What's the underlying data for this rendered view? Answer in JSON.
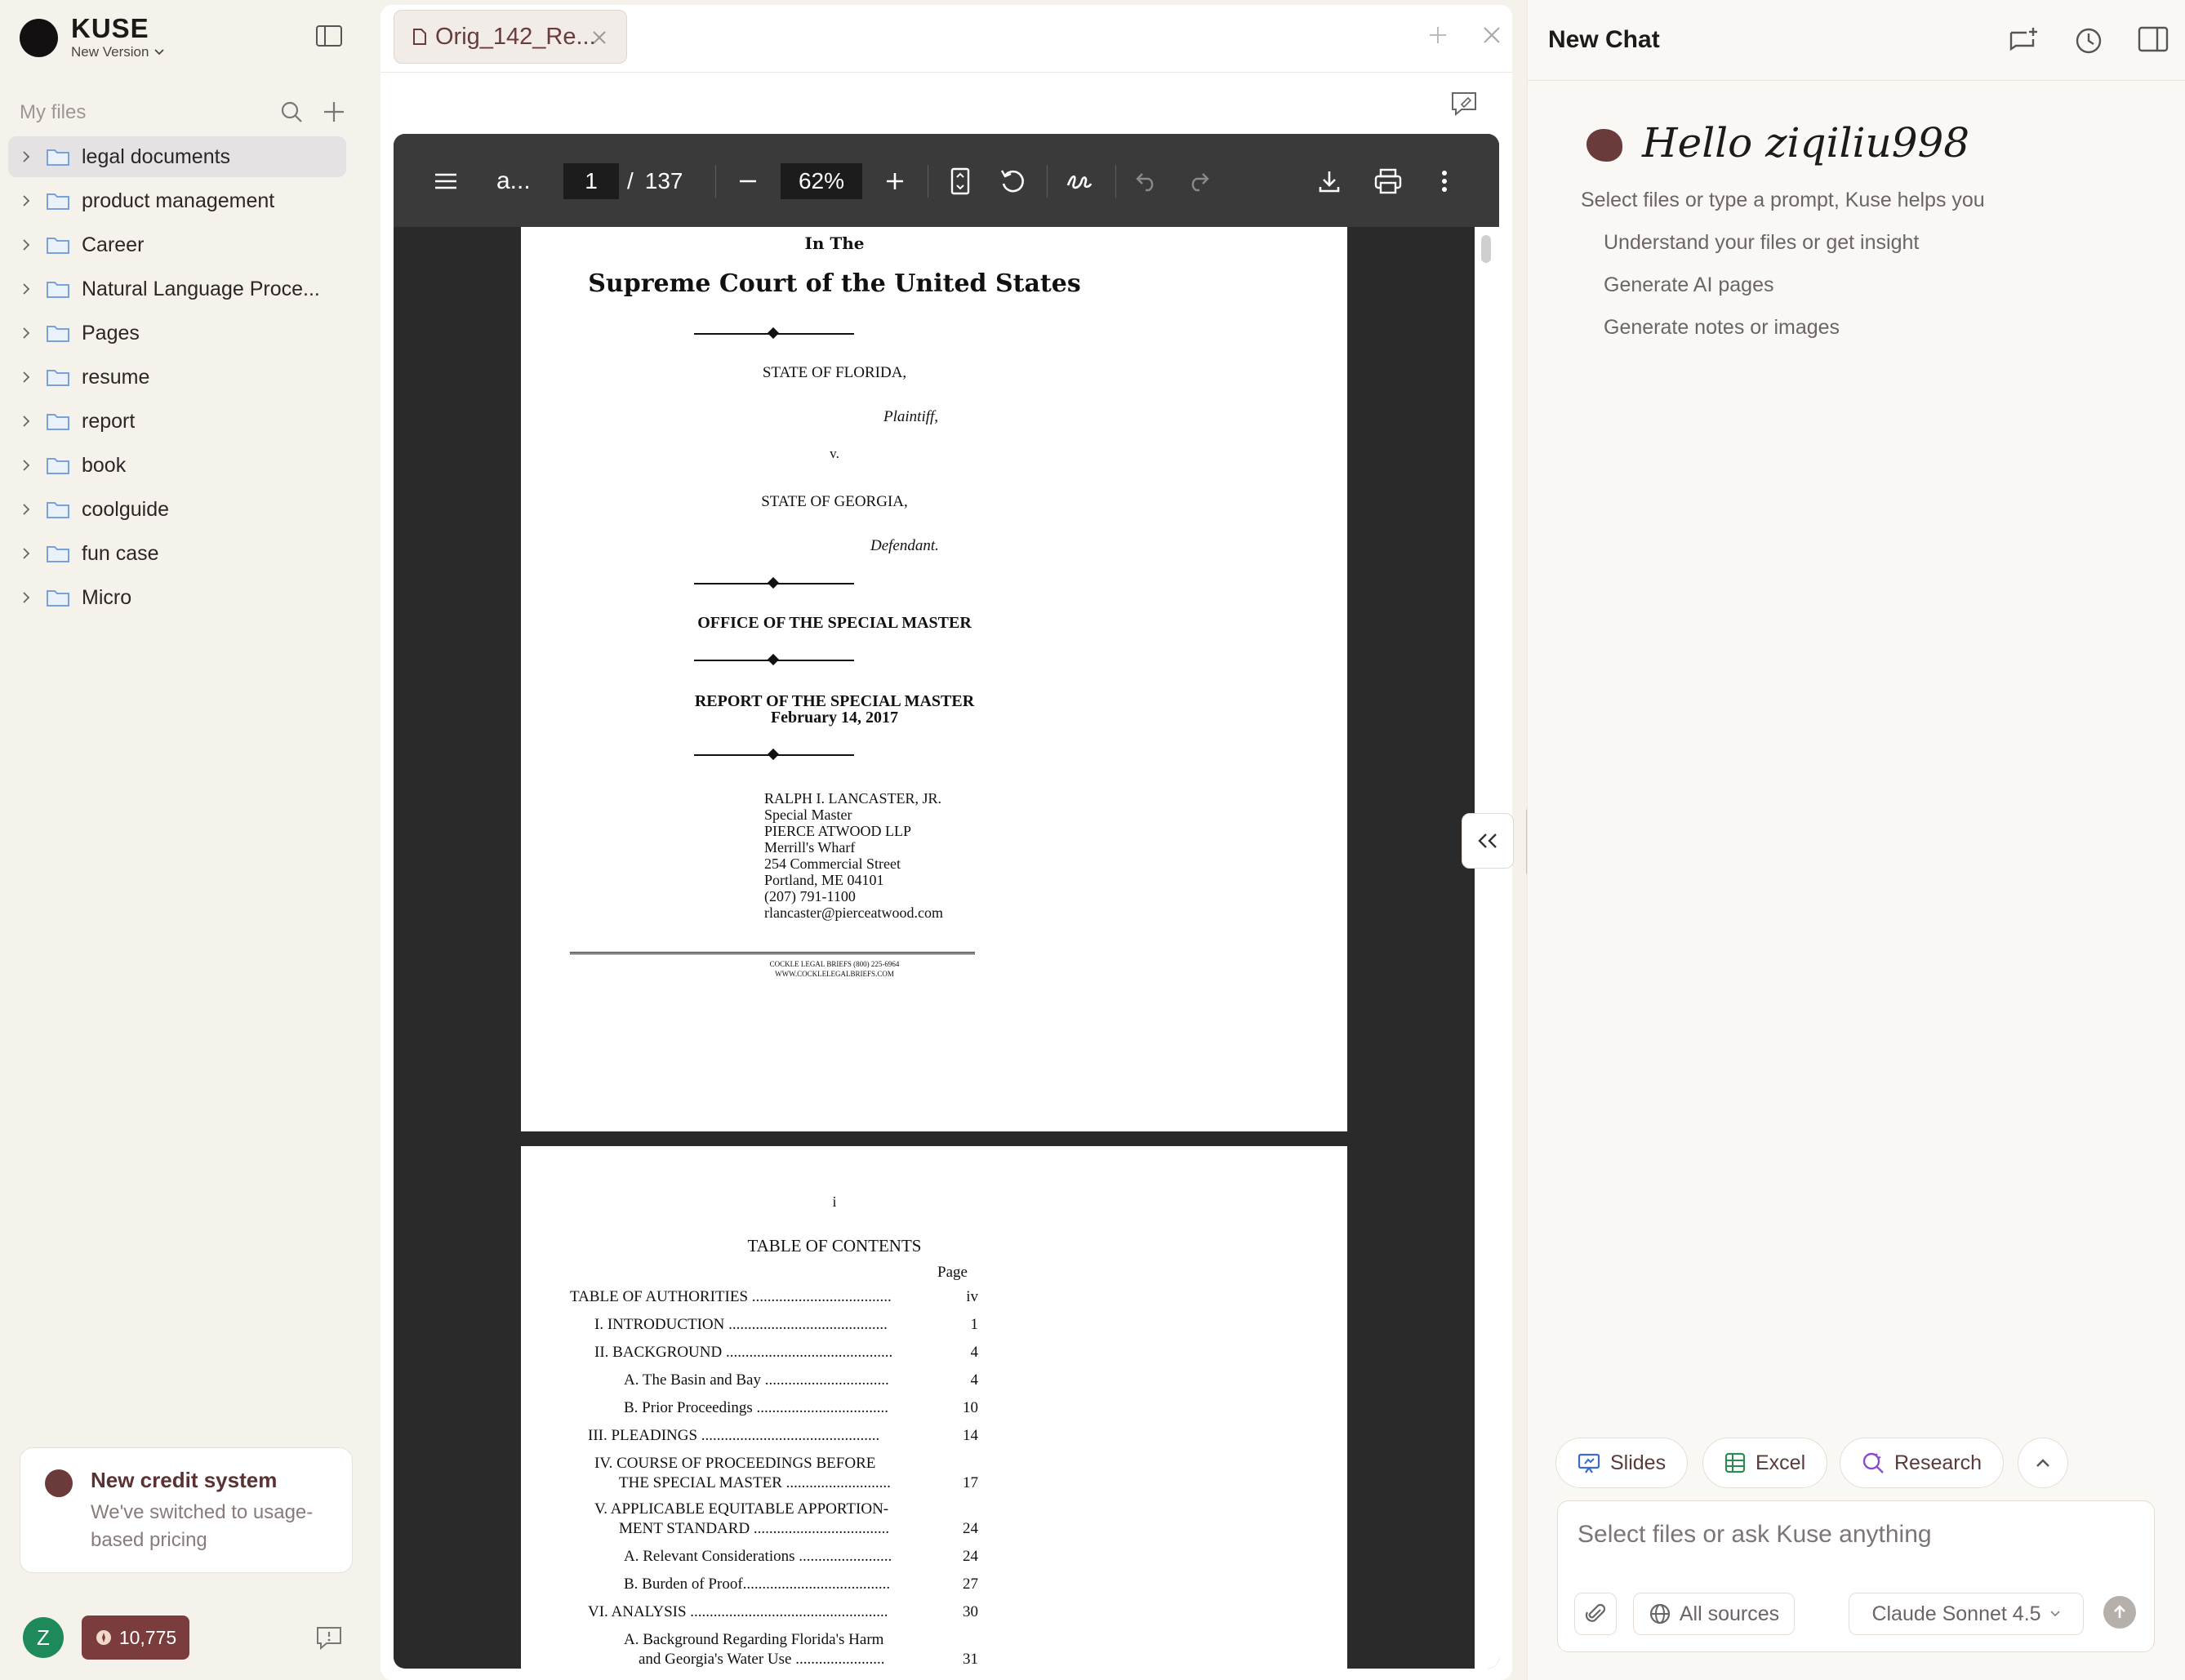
{
  "app": {
    "brand_name": "KUSE",
    "version_label": "New Version"
  },
  "sidebar": {
    "my_files_label": "My files",
    "folders": [
      {
        "label": "legal documents",
        "active": true
      },
      {
        "label": "product management"
      },
      {
        "label": "Career"
      },
      {
        "label": "Natural Language Proce..."
      },
      {
        "label": "Pages"
      },
      {
        "label": "resume"
      },
      {
        "label": "report"
      },
      {
        "label": "book"
      },
      {
        "label": "coolguide"
      },
      {
        "label": "fun case"
      },
      {
        "label": "Micro"
      }
    ],
    "credit_card": {
      "title": "New credit system",
      "subtitle": "We've switched to usage-based pricing"
    },
    "user_initial": "Z",
    "credits": "10,775"
  },
  "viewer": {
    "tab_label": "Orig_142_Re...",
    "toolbar": {
      "doc_name": "a...",
      "current_page": "1",
      "page_sep": "/",
      "total_pages": "137",
      "zoom": "62%"
    },
    "page1": {
      "in_the": "In The",
      "court": "Supreme Court of the United States",
      "plaintiff_name": "STATE OF FLORIDA,",
      "plaintiff_role": "Plaintiff,",
      "versus": "v.",
      "defendant_name": "STATE OF GEORGIA,",
      "defendant_role": "Defendant.",
      "office": "OFFICE OF THE SPECIAL MASTER",
      "report_title": "REPORT OF THE SPECIAL MASTER",
      "report_date": "February 14, 2017",
      "address": [
        "RALPH I. LANCASTER, JR.",
        "Special Master",
        "PIERCE ATWOOD LLP",
        "Merrill's Wharf",
        "254 Commercial Street",
        "Portland, ME 04101",
        "(207) 791-1100",
        "rlancaster@pierceatwood.com"
      ],
      "footer_line1": "COCKLE LEGAL BRIEFS (800) 225-6964",
      "footer_line2": "WWW.COCKLELEGALBRIEFS.COM"
    },
    "page2": {
      "roman": "i",
      "toc_title": "TABLE OF CONTENTS",
      "page_header": "Page",
      "rows": [
        {
          "label": "TABLE OF AUTHORITIES ....................................",
          "page": "iv"
        },
        {
          "label": "I.   INTRODUCTION .........................................",
          "page": "1"
        },
        {
          "label": "II.  BACKGROUND ...........................................",
          "page": "4"
        },
        {
          "label": "A.  The Basin and Bay ................................",
          "page": "4"
        },
        {
          "label": "B.  Prior Proceedings ..................................",
          "page": "10"
        },
        {
          "label": "III. PLEADINGS ..............................................",
          "page": "14"
        },
        {
          "label": "IV.  COURSE OF PROCEEDINGS BEFORE",
          "page": ""
        },
        {
          "label": "THE SPECIAL MASTER ...........................",
          "page": "17"
        },
        {
          "label": "V.   APPLICABLE EQUITABLE APPORTION-",
          "page": ""
        },
        {
          "label": "MENT STANDARD ...................................",
          "page": "24"
        },
        {
          "label": "A.  Relevant Considerations ........................",
          "page": "24"
        },
        {
          "label": "B.  Burden of Proof......................................",
          "page": "27"
        },
        {
          "label": "VI.  ANALYSIS ...................................................",
          "page": "30"
        },
        {
          "label": "A.  Background Regarding Florida's Harm",
          "page": ""
        },
        {
          "label": "and Georgia's Water Use .......................",
          "page": "31"
        }
      ]
    }
  },
  "chat": {
    "title": "New Chat",
    "greeting": "Hello ziqiliu998",
    "subtitle": "Select files or type a prompt, Kuse helps you",
    "options": [
      "Understand your files or get insight",
      "Generate AI pages",
      "Generate notes or images"
    ],
    "chips": {
      "slides": "Slides",
      "excel": "Excel",
      "research": "Research"
    },
    "composer": {
      "placeholder": "Select files or ask Kuse anything",
      "sources_label": "All sources",
      "model_label": "Claude Sonnet 4.5"
    }
  }
}
